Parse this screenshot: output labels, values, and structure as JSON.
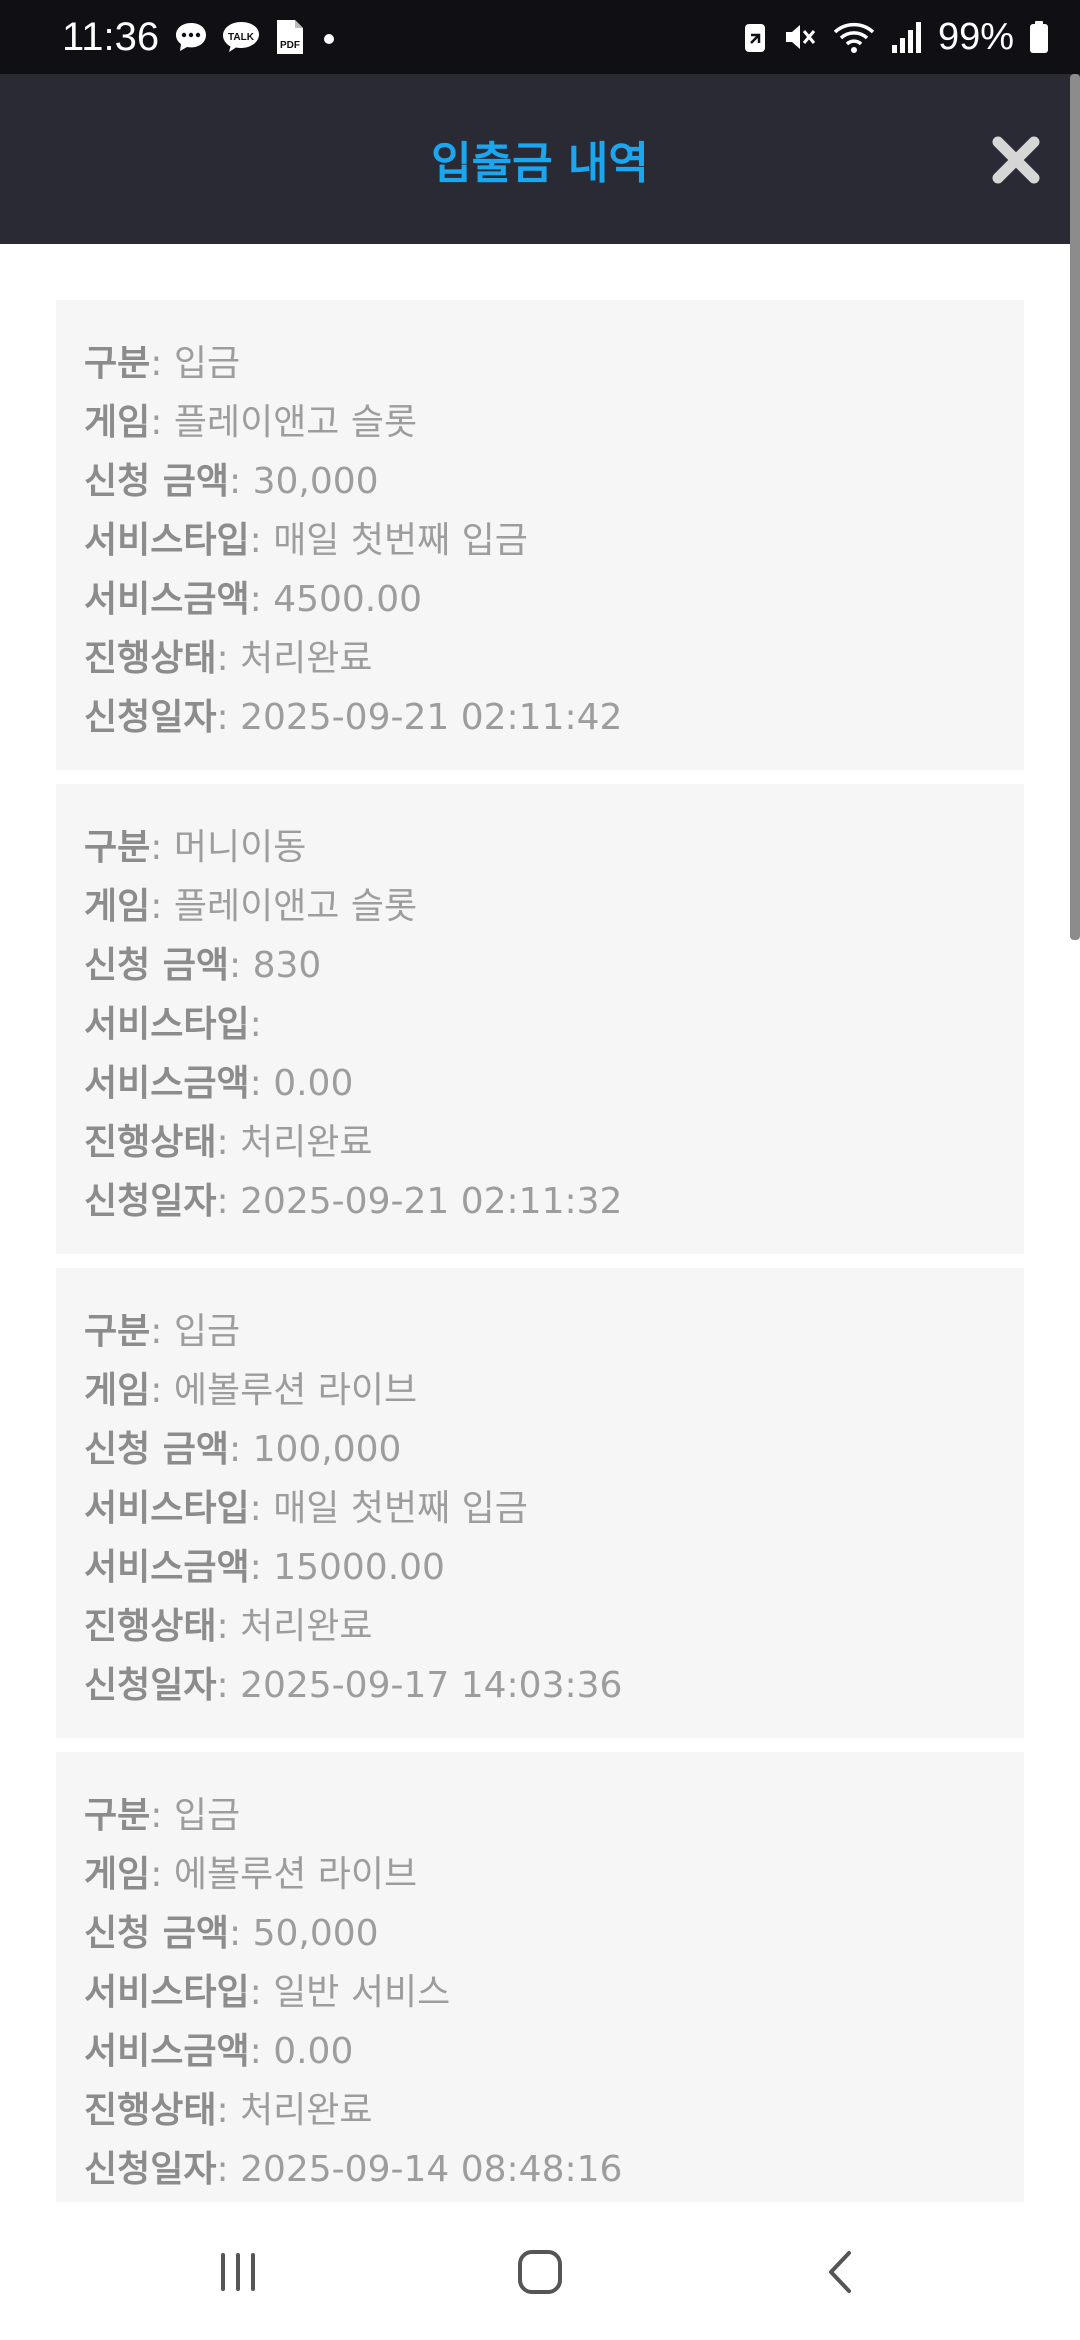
{
  "status_bar": {
    "time": "11:36",
    "battery_percent": "99%",
    "left_icons": [
      "chat-bubble-icon",
      "talk-icon",
      "pdf-icon",
      "dot-icon"
    ],
    "right_icons": [
      "battery-saver-icon",
      "mute-icon",
      "wifi-icon",
      "signal-icon",
      "battery-icon"
    ]
  },
  "header": {
    "title": "입출금 내역",
    "title_color": "#1aa7f0",
    "background": "#2a2a35"
  },
  "labels": {
    "type": "구분",
    "game": "게임",
    "amount": "신청 금액",
    "service_type": "서비스타입",
    "service_amount": "서비스금액",
    "status": "진행상태",
    "date": "신청일자"
  },
  "transactions": [
    {
      "type": "입금",
      "game": "플레이앤고 슬롯",
      "amount": "30,000",
      "service_type": "매일 첫번째 입금",
      "service_amount": "4500.00",
      "status": "처리완료",
      "date": "2025-09-21 02:11:42"
    },
    {
      "type": "머니이동",
      "game": "플레이앤고 슬롯",
      "amount": "830",
      "service_type": "",
      "service_amount": "0.00",
      "status": "처리완료",
      "date": "2025-09-21 02:11:32"
    },
    {
      "type": "입금",
      "game": "에볼루션 라이브",
      "amount": "100,000",
      "service_type": "매일 첫번째 입금",
      "service_amount": "15000.00",
      "status": "처리완료",
      "date": "2025-09-17 14:03:36"
    },
    {
      "type": "입금",
      "game": "에볼루션 라이브",
      "amount": "50,000",
      "service_type": "일반 서비스",
      "service_amount": "0.00",
      "status": "처리완료",
      "date": "2025-09-14 08:48:16"
    }
  ],
  "nav_bar": {
    "icons": [
      "recent-apps-icon",
      "home-icon",
      "back-icon"
    ]
  }
}
